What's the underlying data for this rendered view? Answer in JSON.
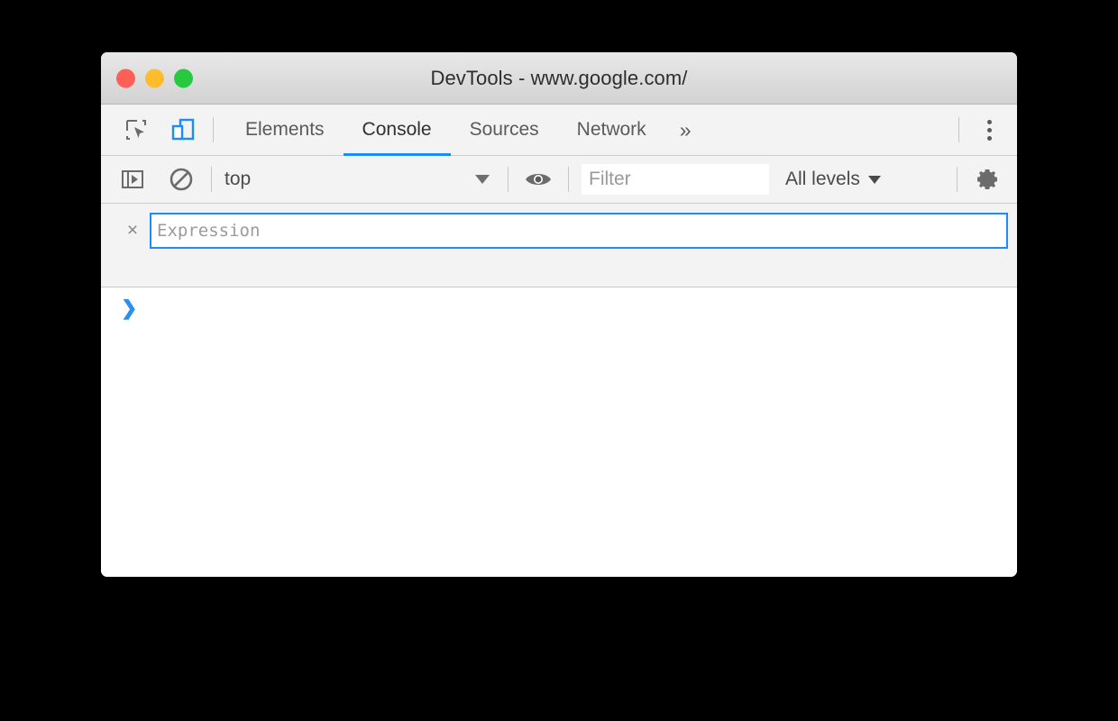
{
  "window": {
    "title": "DevTools - www.google.com/",
    "traffic_lights": [
      {
        "name": "close",
        "color": "#ff5f56"
      },
      {
        "name": "minimize",
        "color": "#ffbd2e"
      },
      {
        "name": "zoom",
        "color": "#27c93f"
      }
    ]
  },
  "toolbar_icons": {
    "inspect": "inspect-element-icon",
    "device": "device-toolbar-icon",
    "kebab": "more-options-icon"
  },
  "tabs": [
    {
      "label": "Elements",
      "active": false
    },
    {
      "label": "Console",
      "active": true
    },
    {
      "label": "Sources",
      "active": false
    },
    {
      "label": "Network",
      "active": false
    }
  ],
  "tab_overflow": "»",
  "console_toolbar": {
    "sidebar_toggle": "console-sidebar-icon",
    "clear_console": "clear-console-icon",
    "context": "top",
    "eye": "live-expression-icon",
    "filter_placeholder": "Filter",
    "filter_value": "",
    "levels": "All levels",
    "settings": "settings-gear-icon"
  },
  "live_expression": {
    "close_label": "×",
    "placeholder": "Expression",
    "value": ""
  },
  "console": {
    "prompt": "❯"
  },
  "colors": {
    "accent": "#1a8cff",
    "toolbar_bg": "#f3f3f3",
    "prompt": "#2a8fee"
  }
}
